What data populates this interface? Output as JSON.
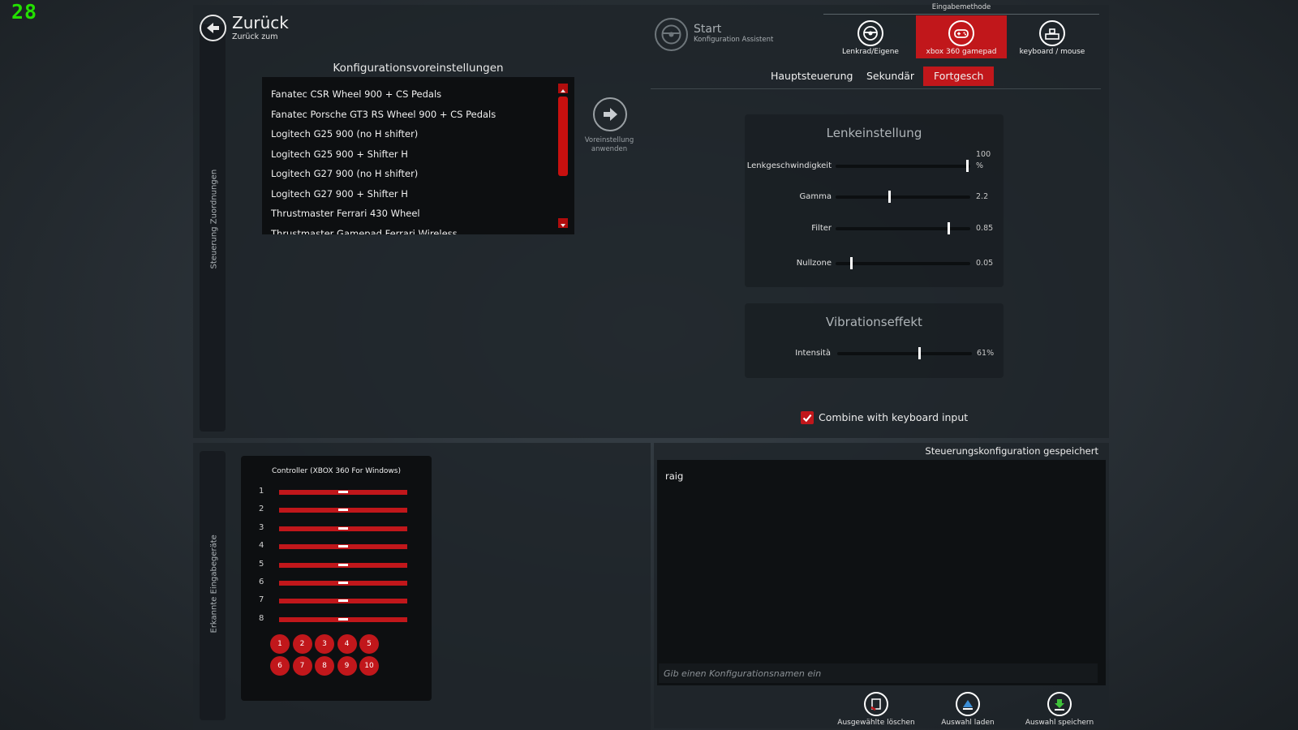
{
  "fps_counter": "28",
  "back": {
    "title": "Zurück",
    "subtitle": "Zurück zum"
  },
  "left_strip_top_label": "Steuerung Zuordnungen",
  "presets": {
    "heading": "Konfigurationsvoreinstellungen",
    "items": [
      "Fanatec CSR Wheel 900 + CS Pedals",
      "Fanatec Porsche GT3 RS Wheel 900 + CS Pedals",
      "Logitech G25 900 (no H shifter)",
      "Logitech G25 900 + Shifter H",
      "Logitech G27 900 (no H shifter)",
      "Logitech G27 900 + Shifter H",
      "Thrustmaster Ferrari 430 Wheel",
      "Thrustmaster Gamepad Ferrari Wireless"
    ],
    "apply_label_line1": "Voreinstellung",
    "apply_label_line2": "anwenden"
  },
  "start": {
    "title": "Start",
    "subtitle": "Konfiguration Assistent"
  },
  "input_method": {
    "heading": "Eingabemethode",
    "options": [
      {
        "label": "Lenkrad/Eigene",
        "icon": "steering-wheel-icon",
        "active": false
      },
      {
        "label": "xbox 360 gamepad",
        "icon": "gamepad-icon",
        "active": true
      },
      {
        "label": "keyboard / mouse",
        "icon": "keyboard-icon",
        "active": false
      }
    ]
  },
  "tabs": [
    {
      "label": "Hauptsteuerung",
      "active": false
    },
    {
      "label": "Sekundär",
      "active": false
    },
    {
      "label": "Fortgesch",
      "active": true
    }
  ],
  "steering": {
    "title": "Lenkeinstellung",
    "sliders": [
      {
        "label": "Lenkgeschwindigkeit",
        "value_line1": "100",
        "value_line2": "%",
        "fraction": 0.98
      },
      {
        "label": "Gamma",
        "value_line1": "2.2",
        "value_line2": "",
        "fraction": 0.4
      },
      {
        "label": "Filter",
        "value_line1": "0.85",
        "value_line2": "",
        "fraction": 0.84
      },
      {
        "label": "Nullzone",
        "value_line1": "0.05",
        "value_line2": "",
        "fraction": 0.12
      }
    ]
  },
  "vibration": {
    "title": "Vibrationseffekt",
    "slider": {
      "label": "Intensità",
      "value": "61%",
      "fraction": 0.61
    }
  },
  "combine_checkbox": {
    "label": "Combine with keyboard input",
    "checked": true
  },
  "left_strip_bottom_label": "Erkannte Eingabegeräte",
  "controller": {
    "title": "Controller (XBOX 360 For Windows)",
    "axes": [
      "1",
      "2",
      "3",
      "4",
      "5",
      "6",
      "7",
      "8"
    ],
    "axis_fraction": 0.5,
    "buttons": [
      "1",
      "2",
      "3",
      "4",
      "5",
      "6",
      "7",
      "8",
      "9",
      "10"
    ]
  },
  "config": {
    "status": "Steuerungskonfiguration gespeichert",
    "entries": [
      "raig"
    ],
    "name_placeholder": "Gib einen Konfigurationsnamen ein",
    "actions": [
      {
        "label": "Ausgewählte löschen",
        "icon": "delete-config-icon"
      },
      {
        "label": "Auswahl laden",
        "icon": "load-config-icon"
      },
      {
        "label": "Auswahl speichern",
        "icon": "save-config-icon"
      }
    ]
  },
  "colors": {
    "accent": "#c1171b",
    "fps": "#23e000"
  }
}
